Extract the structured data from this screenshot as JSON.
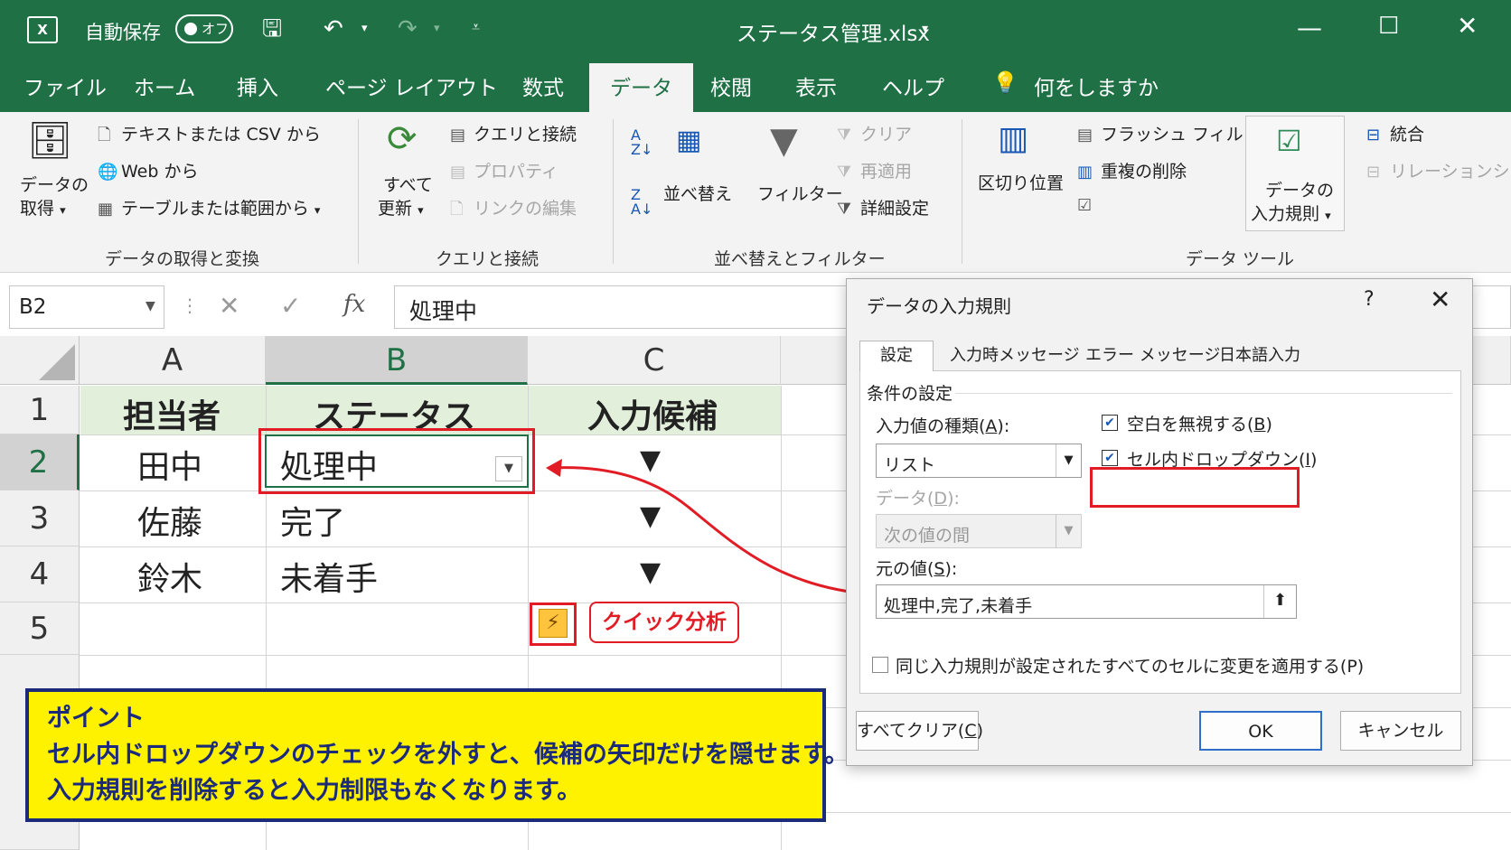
{
  "titlebar": {
    "logo": "X",
    "autosave_label": "自動保存",
    "autosave_state": "オフ",
    "filename": "ステータス管理.xlsx",
    "icons": [
      "excel-icon",
      "save-icon",
      "undo-icon",
      "redo-icon",
      "customize-qat-icon",
      "minimize-icon",
      "maximize-icon",
      "close-icon"
    ]
  },
  "ribbon_tabs": [
    "ファイル",
    "ホーム",
    "挿入",
    "ページ レイアウト",
    "数式",
    "データ",
    "校閲",
    "表示",
    "ヘルプ"
  ],
  "active_tab": "データ",
  "tell_me": "何をしますか",
  "ribbon": {
    "get_transform": {
      "get_data_line1": "データの",
      "get_data_line2": "取得",
      "from_text_csv": "テキストまたは CSV から",
      "from_web": "Web から",
      "from_table": "テーブルまたは範囲から",
      "group": "データの取得と変換"
    },
    "queries": {
      "refresh_line1": "すべて",
      "refresh_line2": "更新",
      "queries_connections": "クエリと接続",
      "properties": "プロパティ",
      "edit_links": "リンクの編集",
      "group": "クエリと接続"
    },
    "sort_filter": {
      "sort": "並べ替え",
      "filter": "フィルター",
      "clear": "クリア",
      "reapply": "再適用",
      "advanced": "詳細設定",
      "group": "並べ替えとフィルター"
    },
    "data_tools": {
      "text_to_columns": "区切り位置",
      "flash_fill": "フラッシュ フィル",
      "remove_duplicates": "重複の削除",
      "validation_line1": "データの",
      "validation_line2": "入力規則",
      "consolidate": "統合",
      "relationships": "リレーションシップ",
      "group": "データ ツール"
    }
  },
  "formula_bar": {
    "name_box": "B2",
    "fx": "fx",
    "value": "処理中"
  },
  "sheet": {
    "columns": [
      "A",
      "B",
      "C"
    ],
    "rows": [
      "1",
      "2",
      "3",
      "4",
      "5"
    ],
    "header": [
      "担当者",
      "ステータス",
      "入力候補"
    ],
    "data": [
      {
        "a": "田中",
        "b": "処理中",
        "c": "▼"
      },
      {
        "a": "佐藤",
        "b": "完了",
        "c": "▼"
      },
      {
        "a": "鈴木",
        "b": "未着手",
        "c": "▼"
      }
    ],
    "quick_analysis_label": "クイック分析"
  },
  "point": {
    "title": "ポイント",
    "line1": "セル内ドロップダウンのチェックを外すと、候補の矢印だけを隠せます。",
    "line2": "入力規則を削除すると入力制限もなくなります。"
  },
  "dialog": {
    "title": "データの入力規則",
    "help": "?",
    "tabs": [
      "設定",
      "入力時メッセージ",
      "エラー メッセージ",
      "日本語入力"
    ],
    "criteria_label": "条件の設定",
    "allow_label_pre": "入力値の種類(",
    "allow_key": "A",
    "allow_label_post": "):",
    "allow_value": "リスト",
    "data_label_pre": "データ(",
    "data_key": "D",
    "data_label_post": "):",
    "data_value": "次の値の間",
    "ignore_blank_pre": "空白を無視する(",
    "ignore_blank_key": "B",
    "ignore_blank_post": ")",
    "in_cell_dropdown_pre": "セル内ドロップダウン(",
    "in_cell_dropdown_key": "I",
    "in_cell_dropdown_post": ")",
    "source_label_pre": "元の値(",
    "source_key": "S",
    "source_label_post": "):",
    "source_value": "処理中,完了,未着手",
    "apply_all": "同じ入力規則が設定されたすべてのセルに変更を適用する(P)",
    "clear_all_pre": "すべてクリア(",
    "clear_all_key": "C",
    "clear_all_post": ")",
    "ok": "OK",
    "cancel": "キャンセル"
  },
  "colors": {
    "excel_green": "#1f7145",
    "header_fill": "#e2efda",
    "annotation_red": "#e21c25",
    "point_yellow": "#fff200",
    "point_navy": "#1c2a7a"
  }
}
